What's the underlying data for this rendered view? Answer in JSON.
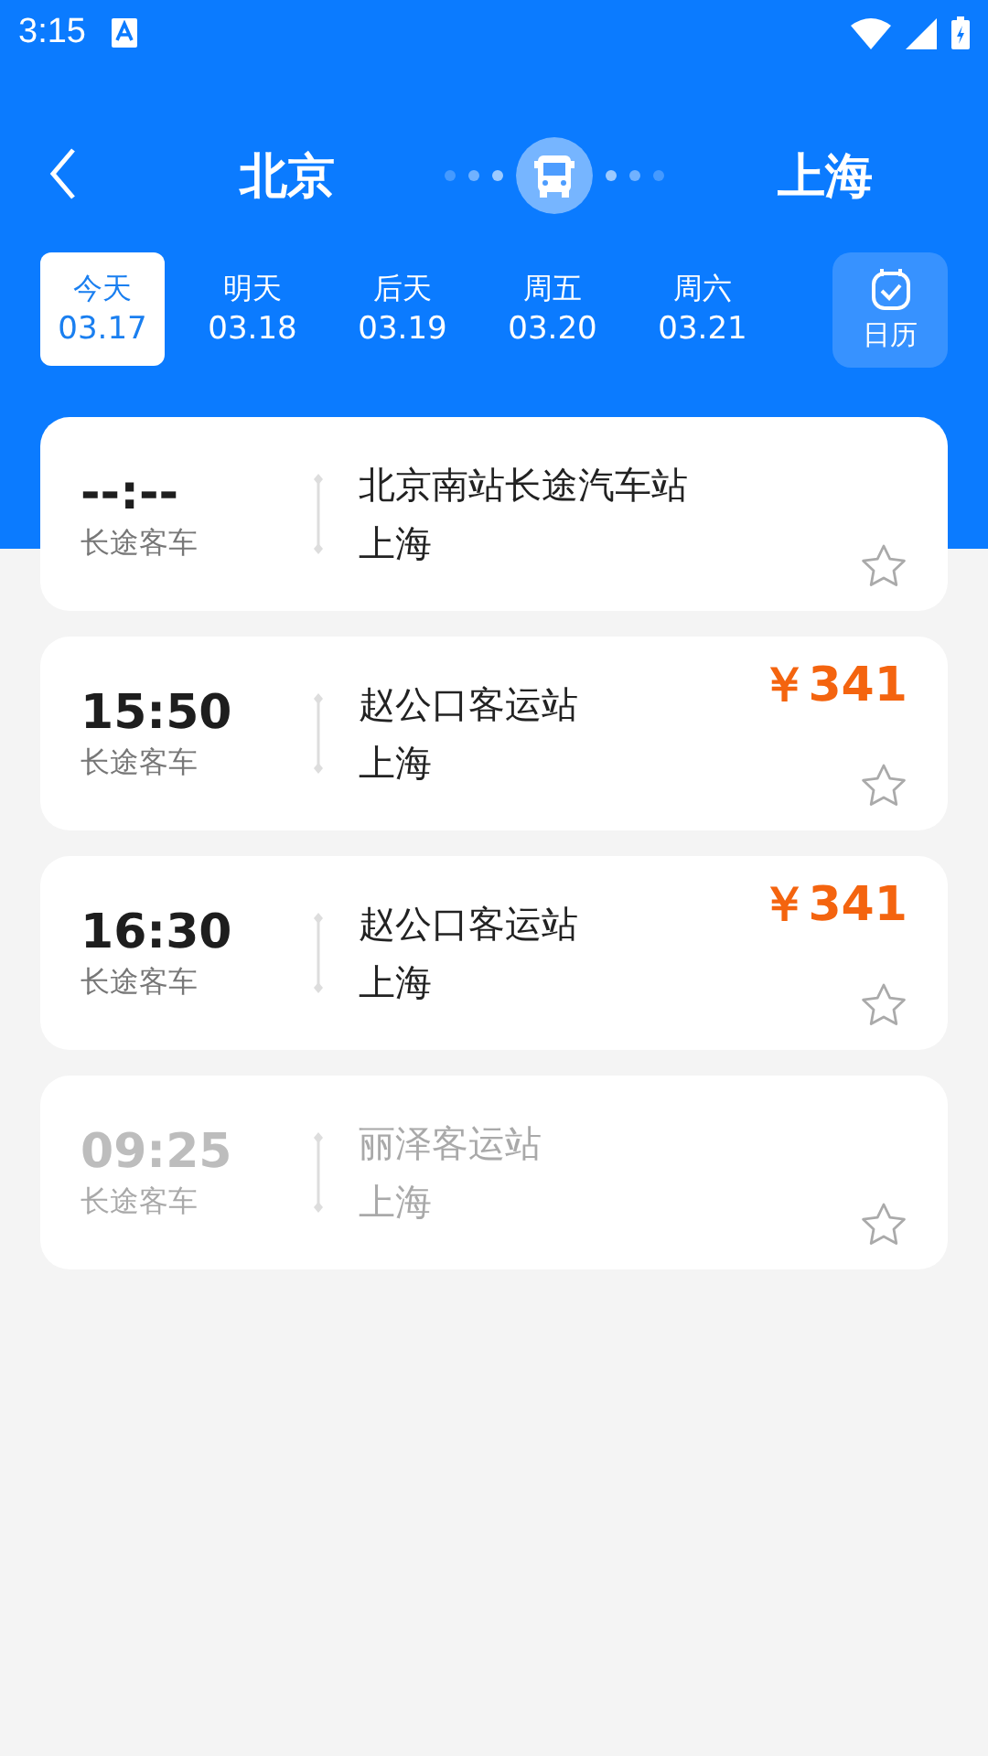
{
  "status_bar": {
    "time": "3:15"
  },
  "route": {
    "from": "北京",
    "to": "上海"
  },
  "dates": [
    {
      "label": "今天",
      "date": "03.17",
      "selected": true
    },
    {
      "label": "明天",
      "date": "03.18",
      "selected": false
    },
    {
      "label": "后天",
      "date": "03.19",
      "selected": false
    },
    {
      "label": "周五",
      "date": "03.20",
      "selected": false
    },
    {
      "label": "周六",
      "date": "03.21",
      "selected": false
    }
  ],
  "calendar_button": {
    "label": "日历"
  },
  "trips": [
    {
      "time": "--:--",
      "type": "长途客车",
      "station": "北京南站长途汽车站",
      "destination": "上海",
      "available": true
    },
    {
      "time": "15:50",
      "type": "长途客车",
      "station": "赵公口客运站",
      "destination": "上海",
      "price": "￥341",
      "available": true
    },
    {
      "time": "16:30",
      "type": "长途客车",
      "station": "赵公口客运站",
      "destination": "上海",
      "price": "￥341",
      "available": true
    },
    {
      "time": "09:25",
      "type": "长途客车",
      "station": "丽泽客运站",
      "destination": "上海",
      "available": false
    }
  ]
}
